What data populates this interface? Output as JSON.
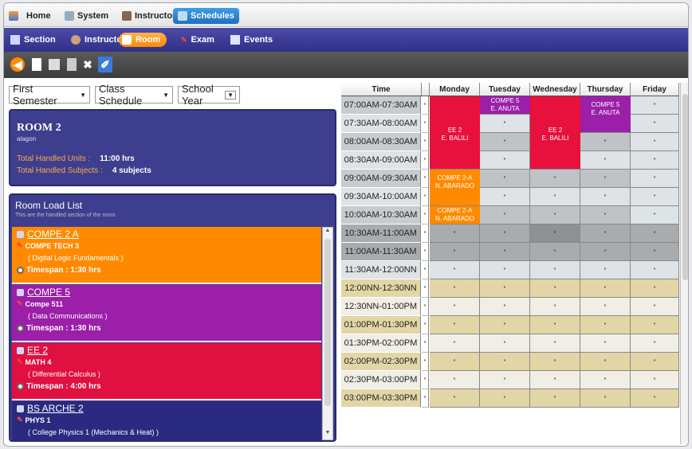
{
  "topmenu": {
    "items": [
      {
        "label": "Home",
        "icon": "home-icon"
      },
      {
        "label": "System",
        "icon": "system-icon"
      },
      {
        "label": "Instructors",
        "icon": "instructors-icon"
      },
      {
        "label": "Schedules",
        "icon": "schedules-icon",
        "active": true
      }
    ]
  },
  "submenu": {
    "items": [
      {
        "label": "Section",
        "icon": "section-icon"
      },
      {
        "label": "Instructor",
        "icon": "instructor-icon"
      },
      {
        "label": "Room",
        "icon": "room-icon",
        "active": true
      },
      {
        "label": "Exam",
        "icon": "exam-icon"
      },
      {
        "label": "Events",
        "icon": "events-icon"
      }
    ]
  },
  "toolbar": {
    "buttons": [
      "back-icon",
      "new-icon",
      "save-icon",
      "save-as-icon",
      "delete-icon",
      "assign-icon"
    ]
  },
  "filters": {
    "semester": "First Semester",
    "view": "Class Schedule",
    "year": "School Year"
  },
  "room": {
    "title": "ROOM 2",
    "subtitle": "alagon",
    "units_label": "Total Handled Units :",
    "units_value": "11:00 hrs",
    "subjects_label": "Total Handled Subjects :",
    "subjects_value": "4 subjects"
  },
  "load_list": {
    "title": "Room Load List",
    "subtitle": "This are the handled section of the room.",
    "items": [
      {
        "code": "COMPE 2 A",
        "subject": "COMPE TECH 3",
        "desc": "( Digital Logic Fundamentals )",
        "timespan": "Timespan : 1:30 hrs",
        "color": "#ff8a00"
      },
      {
        "code": "COMPE 5",
        "subject": "Compe 511",
        "desc": "( Data Communications )",
        "timespan": "Timespan : 1:30 hrs",
        "color": "#9b1fa8"
      },
      {
        "code": "EE 2",
        "subject": "MATH 4",
        "desc": "( Differential Calculus )",
        "timespan": "Timespan : 4:00 hrs",
        "color": "#e01040"
      },
      {
        "code": "BS ARCHE 2",
        "subject": "PHYS 1",
        "desc": "( College Physics 1 (Mechanics & Heat) )",
        "timespan": "",
        "color": "#2a2a80"
      }
    ]
  },
  "schedule": {
    "headers": [
      "Time",
      "Monday",
      "Tuesday",
      "Wednesday",
      "Thursday",
      "Friday"
    ],
    "marker": "*",
    "times": [
      "07:00AM-07:30AM",
      "07:30AM-08:00AM",
      "08:00AM-08:30AM",
      "08:30AM-09:00AM",
      "09:00AM-09:30AM",
      "09:30AM-10:00AM",
      "10:00AM-10:30AM",
      "10:30AM-11:00AM",
      "11:00AM-11:30AM",
      "11:30AM-12:00NN",
      "12:00NN-12:30NN",
      "12:30NN-01:00PM",
      "01:00PM-01:30PM",
      "01:30PM-02:00PM",
      "02:00PM-02:30PM",
      "02:30PM-03:00PM",
      "03:00PM-03:30PM"
    ],
    "blocks": [
      {
        "day": 0,
        "start": 0,
        "len": 4,
        "line1": "EE 2",
        "line2": "E. BALILI",
        "color": "#e8103c"
      },
      {
        "day": 2,
        "start": 0,
        "len": 4,
        "line1": "EE 2",
        "line2": "E. BALILI",
        "color": "#e8103c"
      },
      {
        "day": 1,
        "start": 0,
        "len": 1,
        "line1": "COMPE 5",
        "line2": "E. ANUTA",
        "color": "#9b1fa8"
      },
      {
        "day": 3,
        "start": 0,
        "len": 2,
        "line1": "COMPE 5",
        "line2": "E. ANUTA",
        "color": "#9b1fa8"
      },
      {
        "day": 0,
        "start": 4,
        "len": 2,
        "line1": "COMPE 2-A",
        "line2": "N. ABARADO",
        "color": "#ff8a00"
      },
      {
        "day": 0,
        "start": 6,
        "len": 1,
        "line1": "COMPE 2-A",
        "line2": "N. ABARADO",
        "color": "#ff8a00"
      }
    ]
  }
}
